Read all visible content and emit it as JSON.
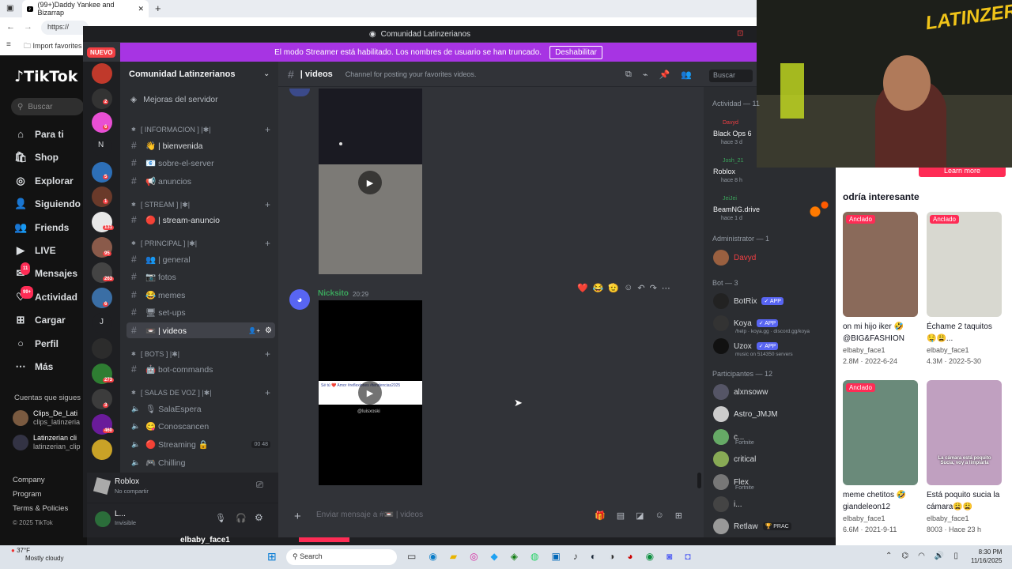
{
  "browser": {
    "tab_title": "(99+)Daddy Yankee and Bizarrap",
    "url": "https://",
    "bookmark": "Import favorites"
  },
  "tiktok": {
    "logo": "TikTok",
    "search_placeholder": "Buscar",
    "nav": [
      {
        "label": "Para ti",
        "icon": "home-icon"
      },
      {
        "label": "Shop",
        "icon": "shop-icon"
      },
      {
        "label": "Explorar",
        "icon": "compass-icon"
      },
      {
        "label": "Siguiendo",
        "icon": "following-icon"
      },
      {
        "label": "Friends",
        "icon": "friends-icon"
      },
      {
        "label": "LIVE",
        "icon": "live-icon"
      },
      {
        "label": "Mensajes",
        "icon": "message-icon",
        "badge": "11"
      },
      {
        "label": "Actividad",
        "icon": "activity-icon",
        "badge": "99+"
      },
      {
        "label": "Cargar",
        "icon": "upload-icon"
      },
      {
        "label": "Perfil",
        "icon": "profile-icon"
      },
      {
        "label": "Más",
        "icon": "more-icon"
      }
    ],
    "following_header": "Cuentas que sigues",
    "following": [
      {
        "name": "Clips_De_Lati",
        "handle": "clips_latinzeria"
      },
      {
        "name": "Latinzerian cli",
        "handle": "latinzerian_clip"
      }
    ],
    "footer": [
      "Company",
      "Program",
      "Terms & Policies",
      "© 2025 TikTok"
    ],
    "right": {
      "learn_more": "Learn more",
      "header": "odría interesante",
      "videos": [
        {
          "pinned": "Anclado",
          "caption1": "on mi hijo iker 🤣",
          "caption2": "@BIG&FASHION",
          "user": "elbaby_face1",
          "stats": "2.8M · 2022-6-24"
        },
        {
          "pinned": "Anclado",
          "caption1": "Échame 2 taquitos",
          "caption2": "🤤😩...",
          "user": "elbaby_face1",
          "stats": "4.3M · 2022-5-30"
        },
        {
          "pinned": "Anclado",
          "caption1": "meme chetitos 🤣",
          "caption2": "giandeleon12",
          "user": "elbaby_face1",
          "stats": "6.6M · 2021-9-11"
        },
        {
          "pinned": "",
          "caption1": "Está poquito sucia la",
          "caption2": "cámara😩😩",
          "user": "elbaby_face1",
          "stats": "8003 · Hace 23 h",
          "overlay": "La cámara está poquito Sucia, voy a limpiarla"
        }
      ],
      "bottom_user": "elbaby_face1"
    }
  },
  "discord": {
    "window_title": "Comunidad Latinzerianos",
    "nuevo": "NUEVO",
    "streamer_text": "El modo Streamer está habilitado. Los nombres de usuario se han truncado.",
    "streamer_button": "Deshabilitar",
    "server_name": "Comunidad Latinzerianos",
    "boost": "Mejoras del servidor",
    "channels": [
      {
        "type": "cat",
        "label": "[ INFORMACION ] |✱|"
      },
      {
        "type": "text",
        "label": "👋 | bienvenida",
        "bright": true
      },
      {
        "type": "text",
        "label": "📧 sobre-el-server"
      },
      {
        "type": "text",
        "label": "📢 anuncios"
      },
      {
        "type": "cat",
        "label": "[ STREAM ] |✱|"
      },
      {
        "type": "text",
        "label": "🔴 | stream-anuncio",
        "bright": true
      },
      {
        "type": "cat",
        "label": "[ PRINCIPAL ] |✱|"
      },
      {
        "type": "text",
        "label": "👥 | general"
      },
      {
        "type": "text",
        "label": "📷 fotos"
      },
      {
        "type": "text",
        "label": "😂 memes"
      },
      {
        "type": "text",
        "label": "🖥 set-ups"
      },
      {
        "type": "text",
        "label": "📼 | videos",
        "active": true
      },
      {
        "type": "cat",
        "label": "[ BOTS ] |✱|"
      },
      {
        "type": "text",
        "label": "🤖 bot-commands"
      },
      {
        "type": "cat",
        "label": "[ SALAS DE VOZ ] |✱|"
      },
      {
        "type": "voice",
        "label": "🎙 SalaEspera"
      },
      {
        "type": "voice",
        "label": "😋 Conoscancen"
      },
      {
        "type": "voice",
        "label": "🔴 Streaming 🔒",
        "counts": "00 48"
      },
      {
        "type": "voice",
        "label": "🎮 Chilling"
      }
    ],
    "voice_panel": {
      "title": "Roblox",
      "sub": "No compartir"
    },
    "user_panel": {
      "name": "L...",
      "status": "Invisible"
    },
    "channel": {
      "name": "| videos",
      "topic": "Channel for posting your favorites videos.",
      "search": "Buscar",
      "input_placeholder": "Enviar mensaje a #📼 | videos"
    },
    "message": {
      "author": "Nicksito",
      "time": "20:29",
      "video_caption": "@luisxoski",
      "video_strip": "Sé tú ❤️ Amor #reflexiones #tendencias2025"
    },
    "members": {
      "activity_header": "Actividad — 11",
      "activities": [
        {
          "name": "Davyd",
          "game": "Black Ops 6",
          "time": "hace 3 d"
        },
        {
          "name": "Josh_21",
          "game": "Roblox",
          "time": "hace 8 h"
        },
        {
          "name": "JeiJei",
          "game": "BeamNG.drive",
          "time": "hace 1 d"
        }
      ],
      "admin_header": "Administrator — 1",
      "admin": "Davyd",
      "bot_header": "Bot — 3",
      "bots": [
        {
          "name": "BotRix",
          "badge": "✓ APP",
          "sub": ""
        },
        {
          "name": "Koya",
          "badge": "✓ APP",
          "sub": "/help · koya.gg · discord.gg/koya"
        },
        {
          "name": "Uzox",
          "badge": "✓ APP",
          "sub": "music on 514350 servers"
        }
      ],
      "part_header": "Participantes — 12",
      "participants": [
        {
          "name": "alxnsoww",
          "sub": ""
        },
        {
          "name": "Astro_JMJM",
          "sub": ""
        },
        {
          "name": "c...",
          "sub": "Fortnite"
        },
        {
          "name": "critical",
          "sub": ""
        },
        {
          "name": "Flex",
          "sub": "Fortnite"
        },
        {
          "name": "i...",
          "sub": ""
        },
        {
          "name": "Retlaw",
          "sub": "",
          "badge": "🏆 PRAC"
        }
      ]
    },
    "server_badges": [
      "2",
      "6",
      "5",
      "1",
      "131",
      "95",
      "263",
      "6",
      "273",
      "3",
      "460"
    ]
  },
  "taskbar": {
    "weather_temp": "37°F",
    "weather_desc": "Mostly cloudy",
    "search": "Search",
    "time": "8:30 PM",
    "date": "11/16/2025"
  }
}
